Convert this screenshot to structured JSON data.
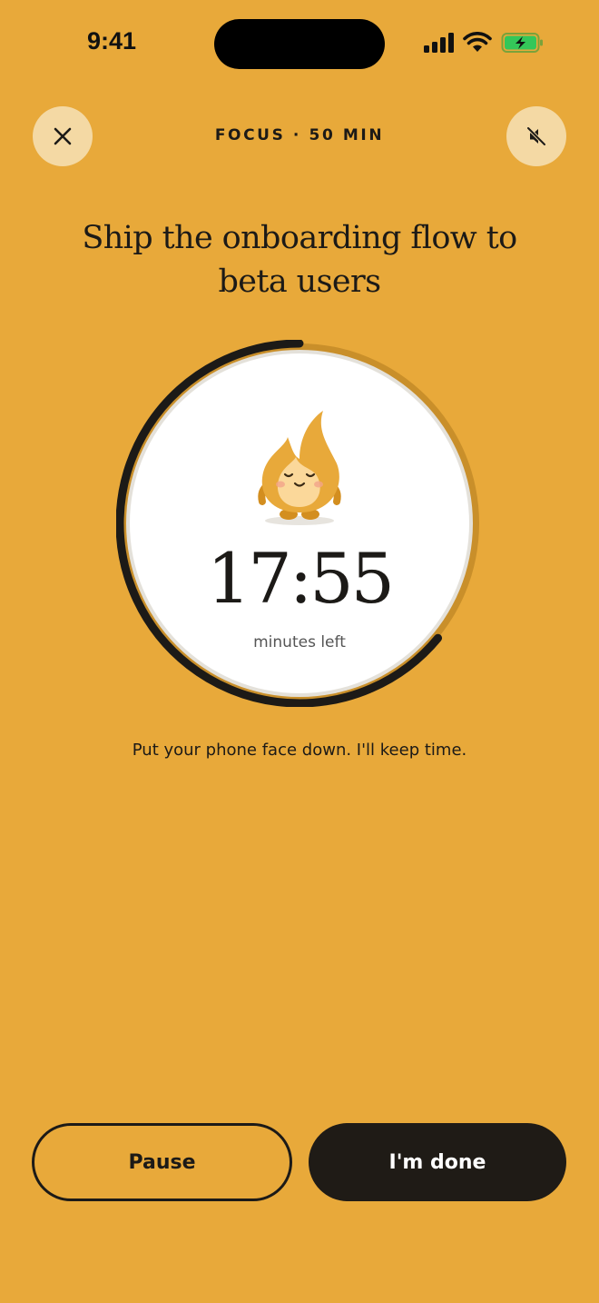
{
  "status_bar": {
    "time": "9:41",
    "icons": [
      "cellular-signal-icon",
      "wifi-icon",
      "battery-charging-icon"
    ],
    "battery_color": "#34C759"
  },
  "header": {
    "close_icon": "close-icon",
    "session_label": "FOCUS · 50 MIN",
    "mute_icon": "speaker-muted-icon"
  },
  "task": {
    "title": "Ship the onboarding flow to beta users"
  },
  "timer": {
    "remaining": "17:55",
    "caption": "minutes left",
    "progress_fraction": 0.36,
    "mascot_icon": "flame-mascot-icon"
  },
  "hint": "Put your phone face down. I'll keep time.",
  "actions": {
    "pause_label": "Pause",
    "done_label": "I'm done"
  },
  "colors": {
    "background": "#E8A93A",
    "button_soft": "#F4D9A4",
    "ink": "#1C1A17",
    "ring_elapsed": "#C98F2A"
  }
}
